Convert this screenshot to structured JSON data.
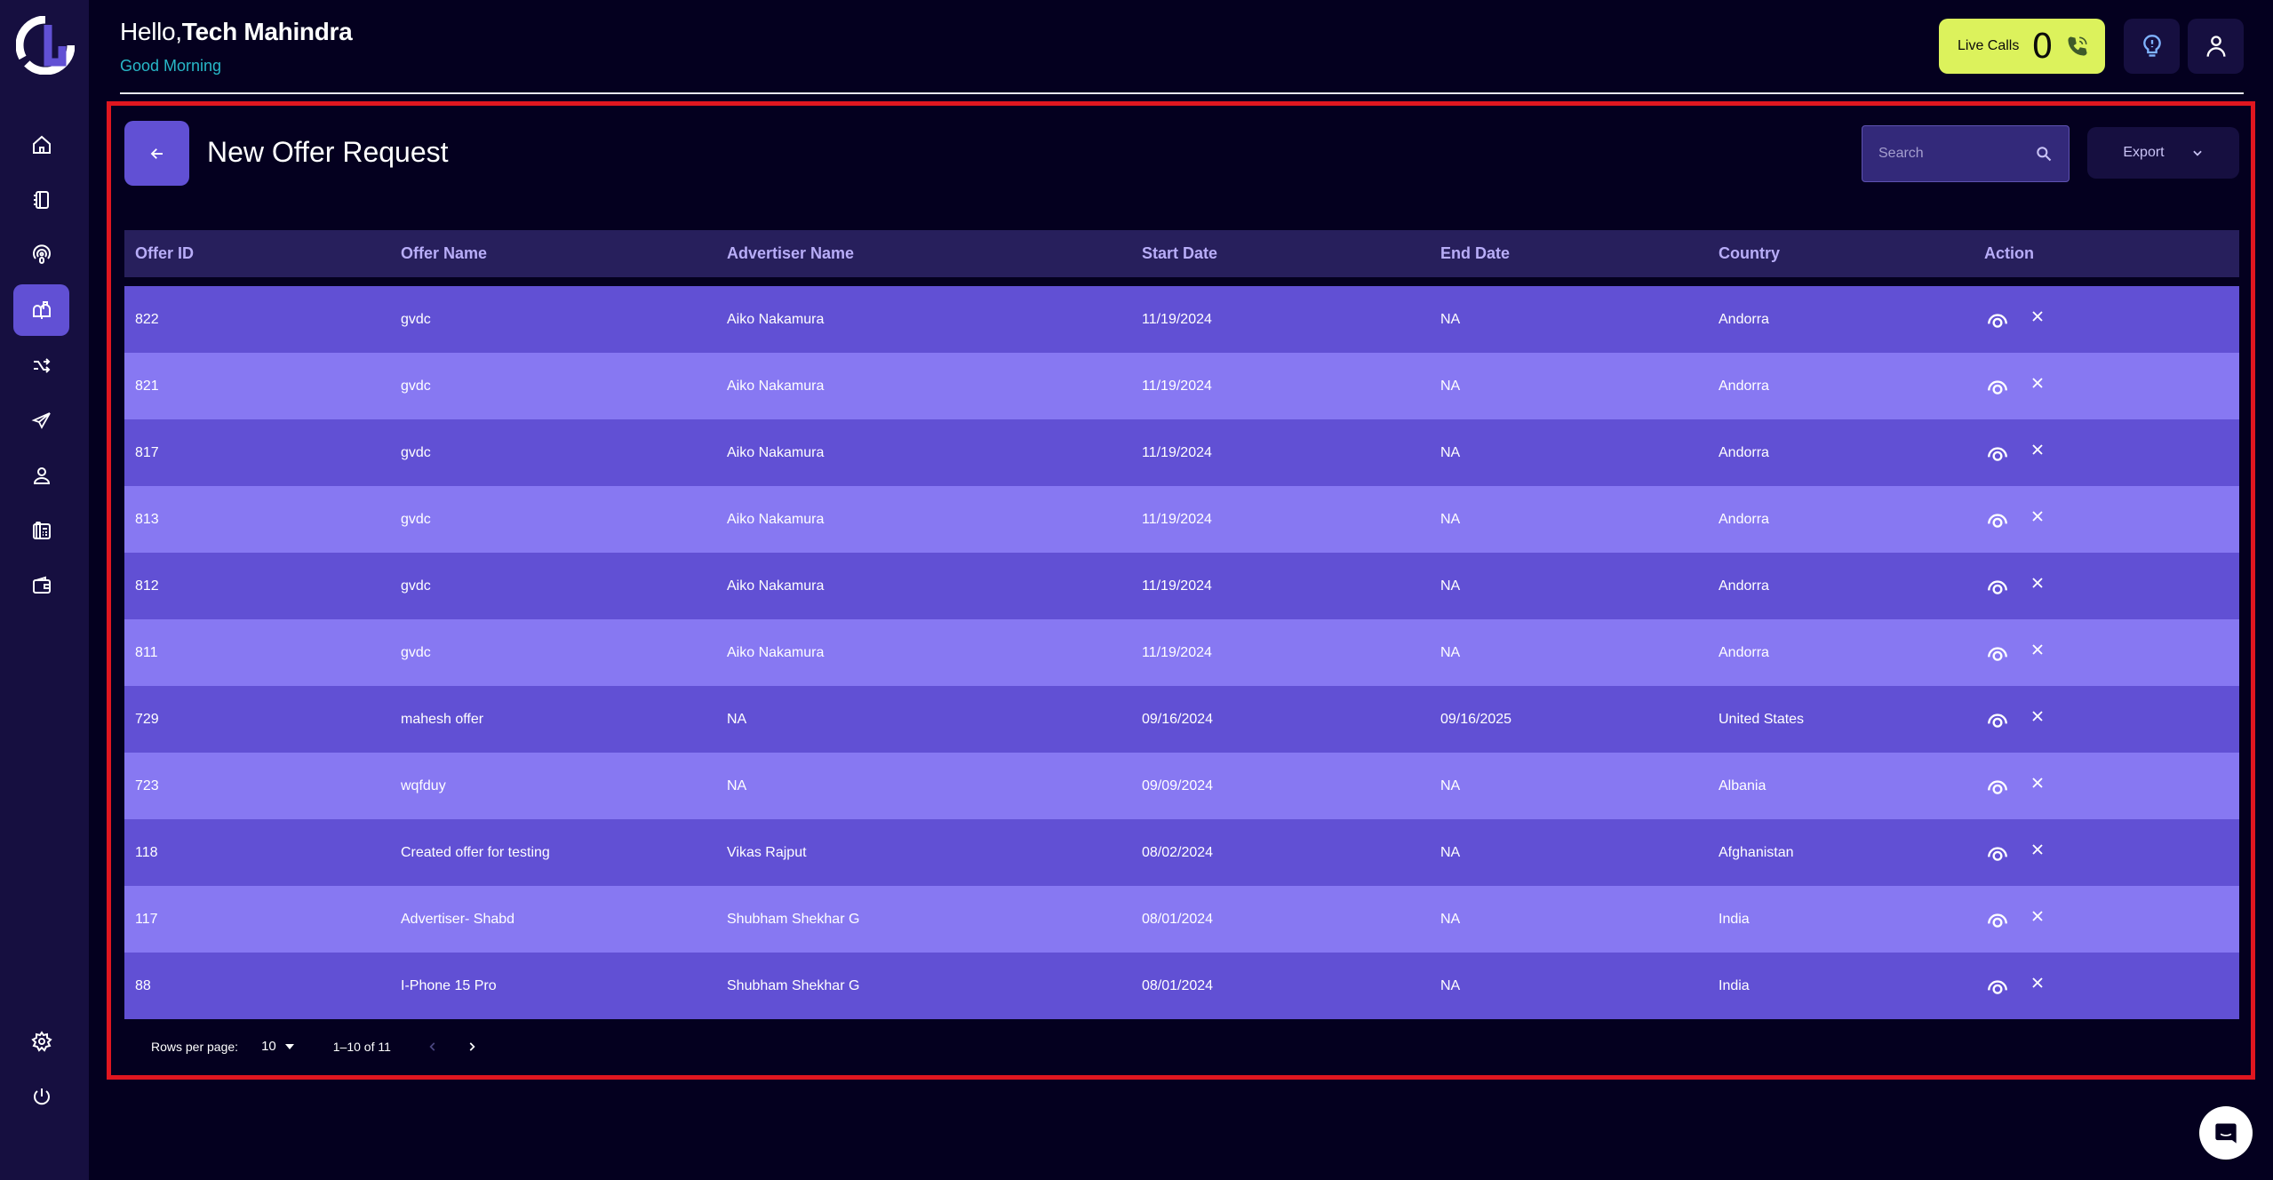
{
  "header": {
    "greeting_prefix": "Hello,",
    "user_name": "Tech Mahindra",
    "sub_greeting": "Good Morning",
    "live_calls_label": "Live Calls",
    "live_calls_count": "0"
  },
  "sidebar": {
    "items": [
      {
        "name": "home",
        "icon": "home-icon",
        "active": false
      },
      {
        "name": "contacts-book",
        "icon": "notebook-icon",
        "active": false
      },
      {
        "name": "broadcast",
        "icon": "podcast-icon",
        "active": false
      },
      {
        "name": "offers",
        "icon": "mailbox-icon",
        "active": true
      },
      {
        "name": "routing",
        "icon": "shuffle-icon",
        "active": false
      },
      {
        "name": "campaigns",
        "icon": "paper-plane-icon",
        "active": false
      },
      {
        "name": "users",
        "icon": "user-icon",
        "active": false
      },
      {
        "name": "phone-numbers",
        "icon": "desk-phone-icon",
        "active": false
      },
      {
        "name": "wallet",
        "icon": "wallet-icon",
        "active": false
      }
    ],
    "bottom": [
      {
        "name": "settings",
        "icon": "gear-icon"
      },
      {
        "name": "logout",
        "icon": "power-icon"
      }
    ]
  },
  "page": {
    "title": "New Offer Request",
    "search_placeholder": "Search",
    "export_label": "Export"
  },
  "table": {
    "columns": [
      "Offer ID",
      "Offer Name",
      "Advertiser Name",
      "Start Date",
      "End Date",
      "Country",
      "Action"
    ],
    "rows": [
      [
        "822",
        "gvdc",
        "Aiko Nakamura",
        "11/19/2024",
        "NA",
        "Andorra"
      ],
      [
        "821",
        "gvdc",
        "Aiko Nakamura",
        "11/19/2024",
        "NA",
        "Andorra"
      ],
      [
        "817",
        "gvdc",
        "Aiko Nakamura",
        "11/19/2024",
        "NA",
        "Andorra"
      ],
      [
        "813",
        "gvdc",
        "Aiko Nakamura",
        "11/19/2024",
        "NA",
        "Andorra"
      ],
      [
        "812",
        "gvdc",
        "Aiko Nakamura",
        "11/19/2024",
        "NA",
        "Andorra"
      ],
      [
        "811",
        "gvdc",
        "Aiko Nakamura",
        "11/19/2024",
        "NA",
        "Andorra"
      ],
      [
        "729",
        "mahesh offer",
        "NA",
        "09/16/2024",
        "09/16/2025",
        "United States"
      ],
      [
        "723",
        "wqfduy",
        "NA",
        "09/09/2024",
        "NA",
        "Albania"
      ],
      [
        "118",
        "Created offer for testing",
        "Vikas Rajput",
        "08/02/2024",
        "NA",
        "Afghanistan"
      ],
      [
        "117",
        "Advertiser- Shabd",
        "Shubham Shekhar G",
        "08/01/2024",
        "NA",
        "India"
      ],
      [
        "88",
        "I-Phone 15 Pro",
        "Shubham Shekhar G",
        "08/01/2024",
        "NA",
        "India"
      ]
    ]
  },
  "pagination": {
    "rows_per_page_label": "Rows per page:",
    "rows_per_page_value": "10",
    "range_label": "1–10 of 11"
  },
  "colors": {
    "accent": "#6150d4",
    "row_alt": "#8778f2",
    "live_calls_bg": "#dcf25c",
    "highlight_border": "#e0161f"
  }
}
